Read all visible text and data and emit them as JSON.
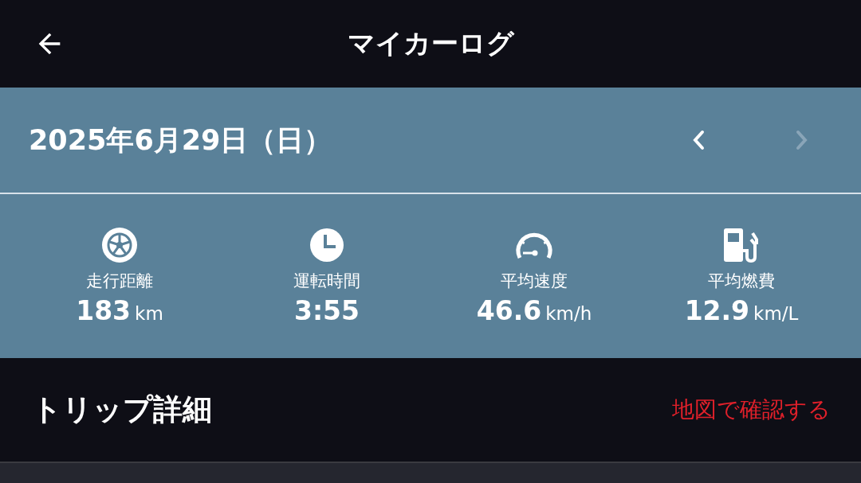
{
  "header": {
    "title": "マイカーログ"
  },
  "date_bar": {
    "date": "2025年6月29日（日）",
    "prev": {
      "disabled": false
    },
    "next": {
      "disabled": true
    }
  },
  "stats": [
    {
      "kind": "distance",
      "label": "走行距離",
      "value": "183",
      "unit": "km"
    },
    {
      "kind": "time",
      "label": "運転時間",
      "value": "3:55"
    },
    {
      "kind": "speed",
      "label": "平均速度",
      "value": "46.6",
      "unit": "km/h"
    },
    {
      "kind": "fuel",
      "label": "平均燃費",
      "value": "12.9",
      "unit": "km/L"
    }
  ],
  "trip_section": {
    "title": "トリップ詳細",
    "map_link": "地図で確認する"
  }
}
